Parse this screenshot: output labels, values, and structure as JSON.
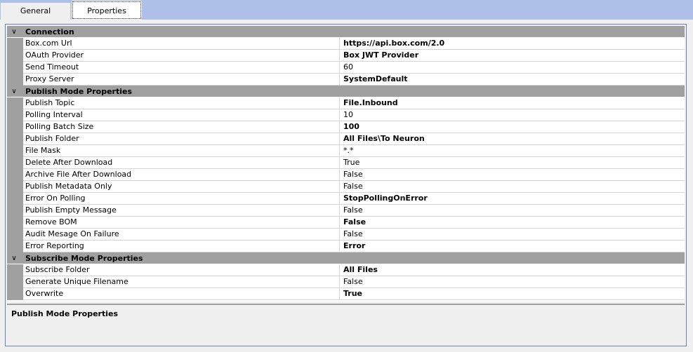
{
  "tabs": [
    {
      "label": "General",
      "active": false
    },
    {
      "label": "Properties",
      "active": true
    }
  ],
  "categories": [
    {
      "title": "Connection",
      "rows": [
        {
          "label": "Box.com Url",
          "value": "https://api.box.com/2.0",
          "bold": true
        },
        {
          "label": "OAuth Provider",
          "value": "Box JWT Provider",
          "bold": true
        },
        {
          "label": "Send Timeout",
          "value": "60",
          "bold": false
        },
        {
          "label": "Proxy Server",
          "value": "SystemDefault",
          "bold": true
        }
      ]
    },
    {
      "title": "Publish Mode Properties",
      "rows": [
        {
          "label": "Publish Topic",
          "value": "File.Inbound",
          "bold": true
        },
        {
          "label": "Polling Interval",
          "value": "10",
          "bold": false
        },
        {
          "label": "Polling Batch Size",
          "value": "100",
          "bold": true
        },
        {
          "label": "Publish Folder",
          "value": "All Files\\To Neuron",
          "bold": true
        },
        {
          "label": "File Mask",
          "value": "*.*",
          "bold": false
        },
        {
          "label": "Delete After Download",
          "value": "True",
          "bold": false
        },
        {
          "label": "Archive File After Download",
          "value": "False",
          "bold": false
        },
        {
          "label": "Publish Metadata Only",
          "value": "False",
          "bold": false
        },
        {
          "label": "Error On Polling",
          "value": "StopPollingOnError",
          "bold": true
        },
        {
          "label": "Publish Empty Message",
          "value": "False",
          "bold": false
        },
        {
          "label": "Remove BOM",
          "value": "False",
          "bold": true
        },
        {
          "label": "Audit Mesage On Failure",
          "value": "False",
          "bold": false
        },
        {
          "label": "Error Reporting",
          "value": "Error",
          "bold": true
        }
      ]
    },
    {
      "title": "Subscribe Mode Properties",
      "rows": [
        {
          "label": "Subscribe Folder",
          "value": "All Files",
          "bold": true
        },
        {
          "label": "Generate Unique Filename",
          "value": "False",
          "bold": false
        },
        {
          "label": "Overwrite",
          "value": "True",
          "bold": true
        }
      ]
    }
  ],
  "help": {
    "title": "Publish Mode Properties"
  },
  "icons": {
    "collapse": "chevron-down-icon"
  }
}
